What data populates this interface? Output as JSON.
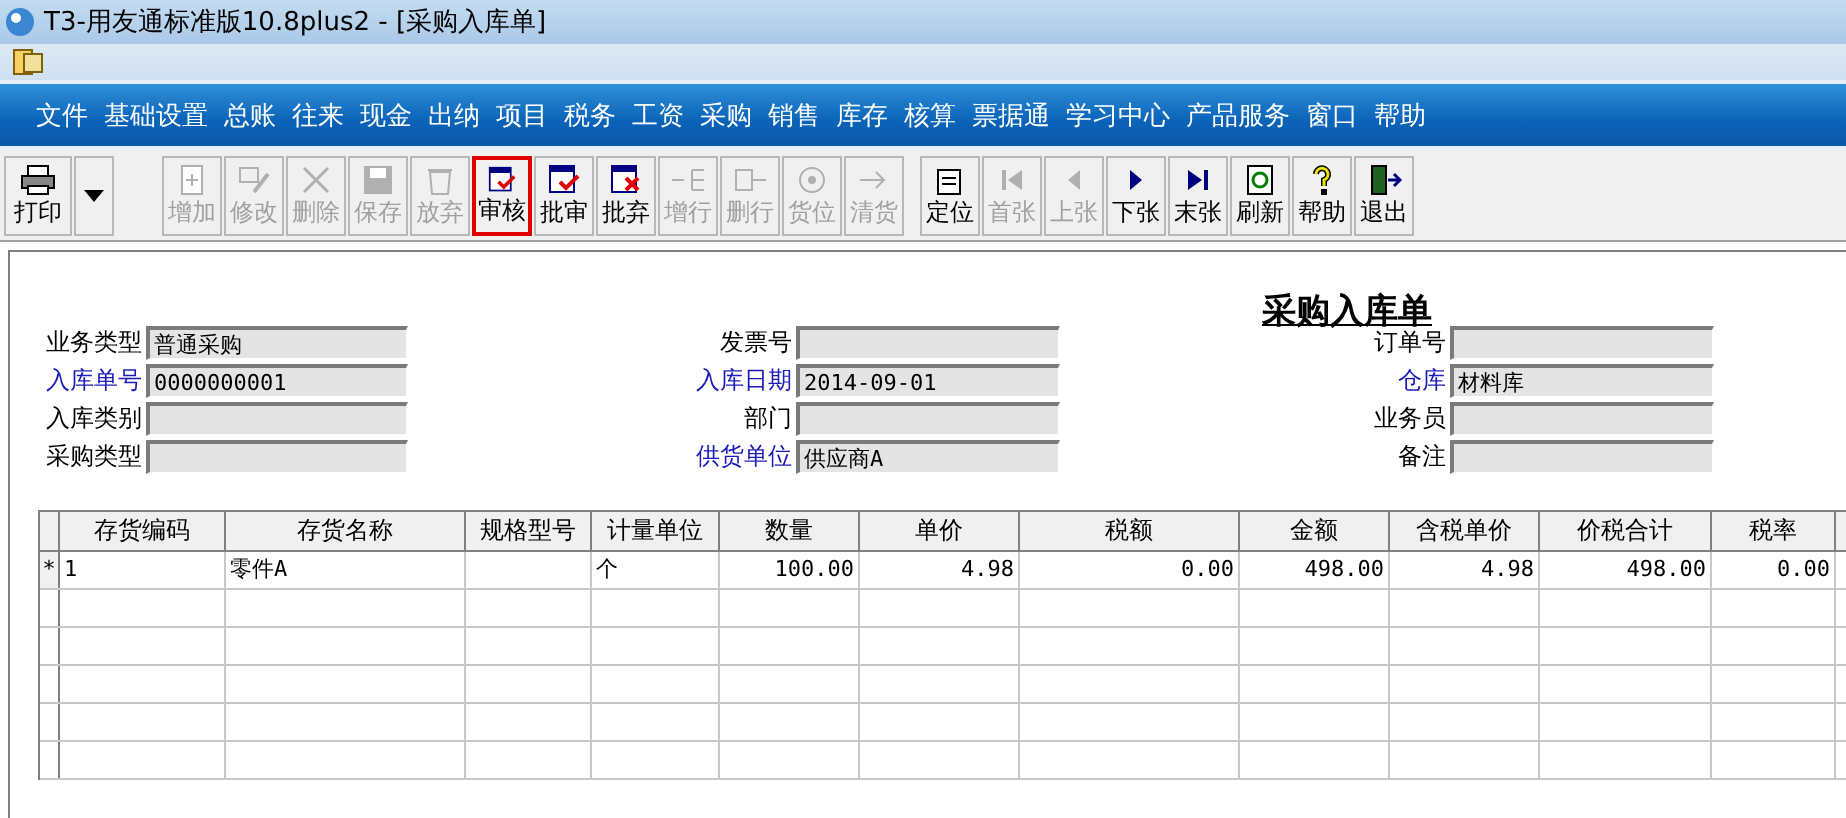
{
  "window": {
    "title": "T3-用友通标准版10.8plus2 - [采购入库单]"
  },
  "menu": [
    "文件",
    "基础设置",
    "总账",
    "往来",
    "现金",
    "出纳",
    "项目",
    "税务",
    "工资",
    "采购",
    "销售",
    "库存",
    "核算",
    "票据通",
    "学习中心",
    "产品服务",
    "窗口",
    "帮助"
  ],
  "toolbar": [
    {
      "label": "打印",
      "disabled": false,
      "highlighted": false,
      "kind": "print"
    },
    {
      "label": "增加",
      "disabled": true,
      "highlighted": false,
      "kind": "add"
    },
    {
      "label": "修改",
      "disabled": true,
      "highlighted": false,
      "kind": "edit"
    },
    {
      "label": "删除",
      "disabled": true,
      "highlighted": false,
      "kind": "delete"
    },
    {
      "label": "保存",
      "disabled": true,
      "highlighted": false,
      "kind": "save"
    },
    {
      "label": "放弃",
      "disabled": true,
      "highlighted": false,
      "kind": "discard"
    },
    {
      "label": "审核",
      "disabled": false,
      "highlighted": true,
      "kind": "approve"
    },
    {
      "label": "批审",
      "disabled": false,
      "highlighted": false,
      "kind": "approve"
    },
    {
      "label": "批弃",
      "disabled": false,
      "highlighted": false,
      "kind": "reject"
    },
    {
      "label": "增行",
      "disabled": true,
      "highlighted": false,
      "kind": "addrow"
    },
    {
      "label": "删行",
      "disabled": true,
      "highlighted": false,
      "kind": "delrow"
    },
    {
      "label": "货位",
      "disabled": true,
      "highlighted": false,
      "kind": "location"
    },
    {
      "label": "清货",
      "disabled": true,
      "highlighted": false,
      "kind": "clear"
    },
    {
      "label": "定位",
      "disabled": false,
      "highlighted": false,
      "kind": "locate"
    },
    {
      "label": "首张",
      "disabled": true,
      "highlighted": false,
      "kind": "first"
    },
    {
      "label": "上张",
      "disabled": true,
      "highlighted": false,
      "kind": "prev"
    },
    {
      "label": "下张",
      "disabled": false,
      "highlighted": false,
      "kind": "next"
    },
    {
      "label": "末张",
      "disabled": false,
      "highlighted": false,
      "kind": "last"
    },
    {
      "label": "刷新",
      "disabled": false,
      "highlighted": false,
      "kind": "refresh"
    },
    {
      "label": "帮助",
      "disabled": false,
      "highlighted": false,
      "kind": "help"
    },
    {
      "label": "退出",
      "disabled": false,
      "highlighted": false,
      "kind": "exit"
    }
  ],
  "form": {
    "title": "采购入库单",
    "columns": [
      [
        {
          "label": "业务类型",
          "required": false,
          "value": "普通采购"
        },
        {
          "label": "入库单号",
          "required": true,
          "value": "0000000001"
        },
        {
          "label": "入库类别",
          "required": false
        },
        {
          "label": "采购类型",
          "required": false
        }
      ],
      [
        {
          "label": "发票号",
          "required": false
        },
        {
          "label": "入库日期",
          "required": true,
          "value": "2014-09-01"
        },
        {
          "label": "部门",
          "required": false
        },
        {
          "label": "供货单位",
          "required": true,
          "value": "供应商A"
        }
      ],
      [
        {
          "label": "订单号",
          "required": false
        },
        {
          "label": "仓库",
          "required": true,
          "value": "材料库"
        },
        {
          "label": "业务员",
          "required": false
        },
        {
          "label": "备注",
          "required": false
        }
      ]
    ]
  },
  "table": {
    "columns": [
      "存货编码",
      "存货名称",
      "规格型号",
      "计量单位",
      "数量",
      "单价",
      "税额",
      "金额",
      "含税单价",
      "价税合计",
      "税率"
    ],
    "rows": [
      {
        "marker": "*",
        "cells": [
          "1",
          "零件A",
          "",
          "个",
          "100.00",
          "4.98",
          "0.00",
          "498.00",
          "4.98",
          "498.00",
          "0.00"
        ]
      }
    ]
  }
}
